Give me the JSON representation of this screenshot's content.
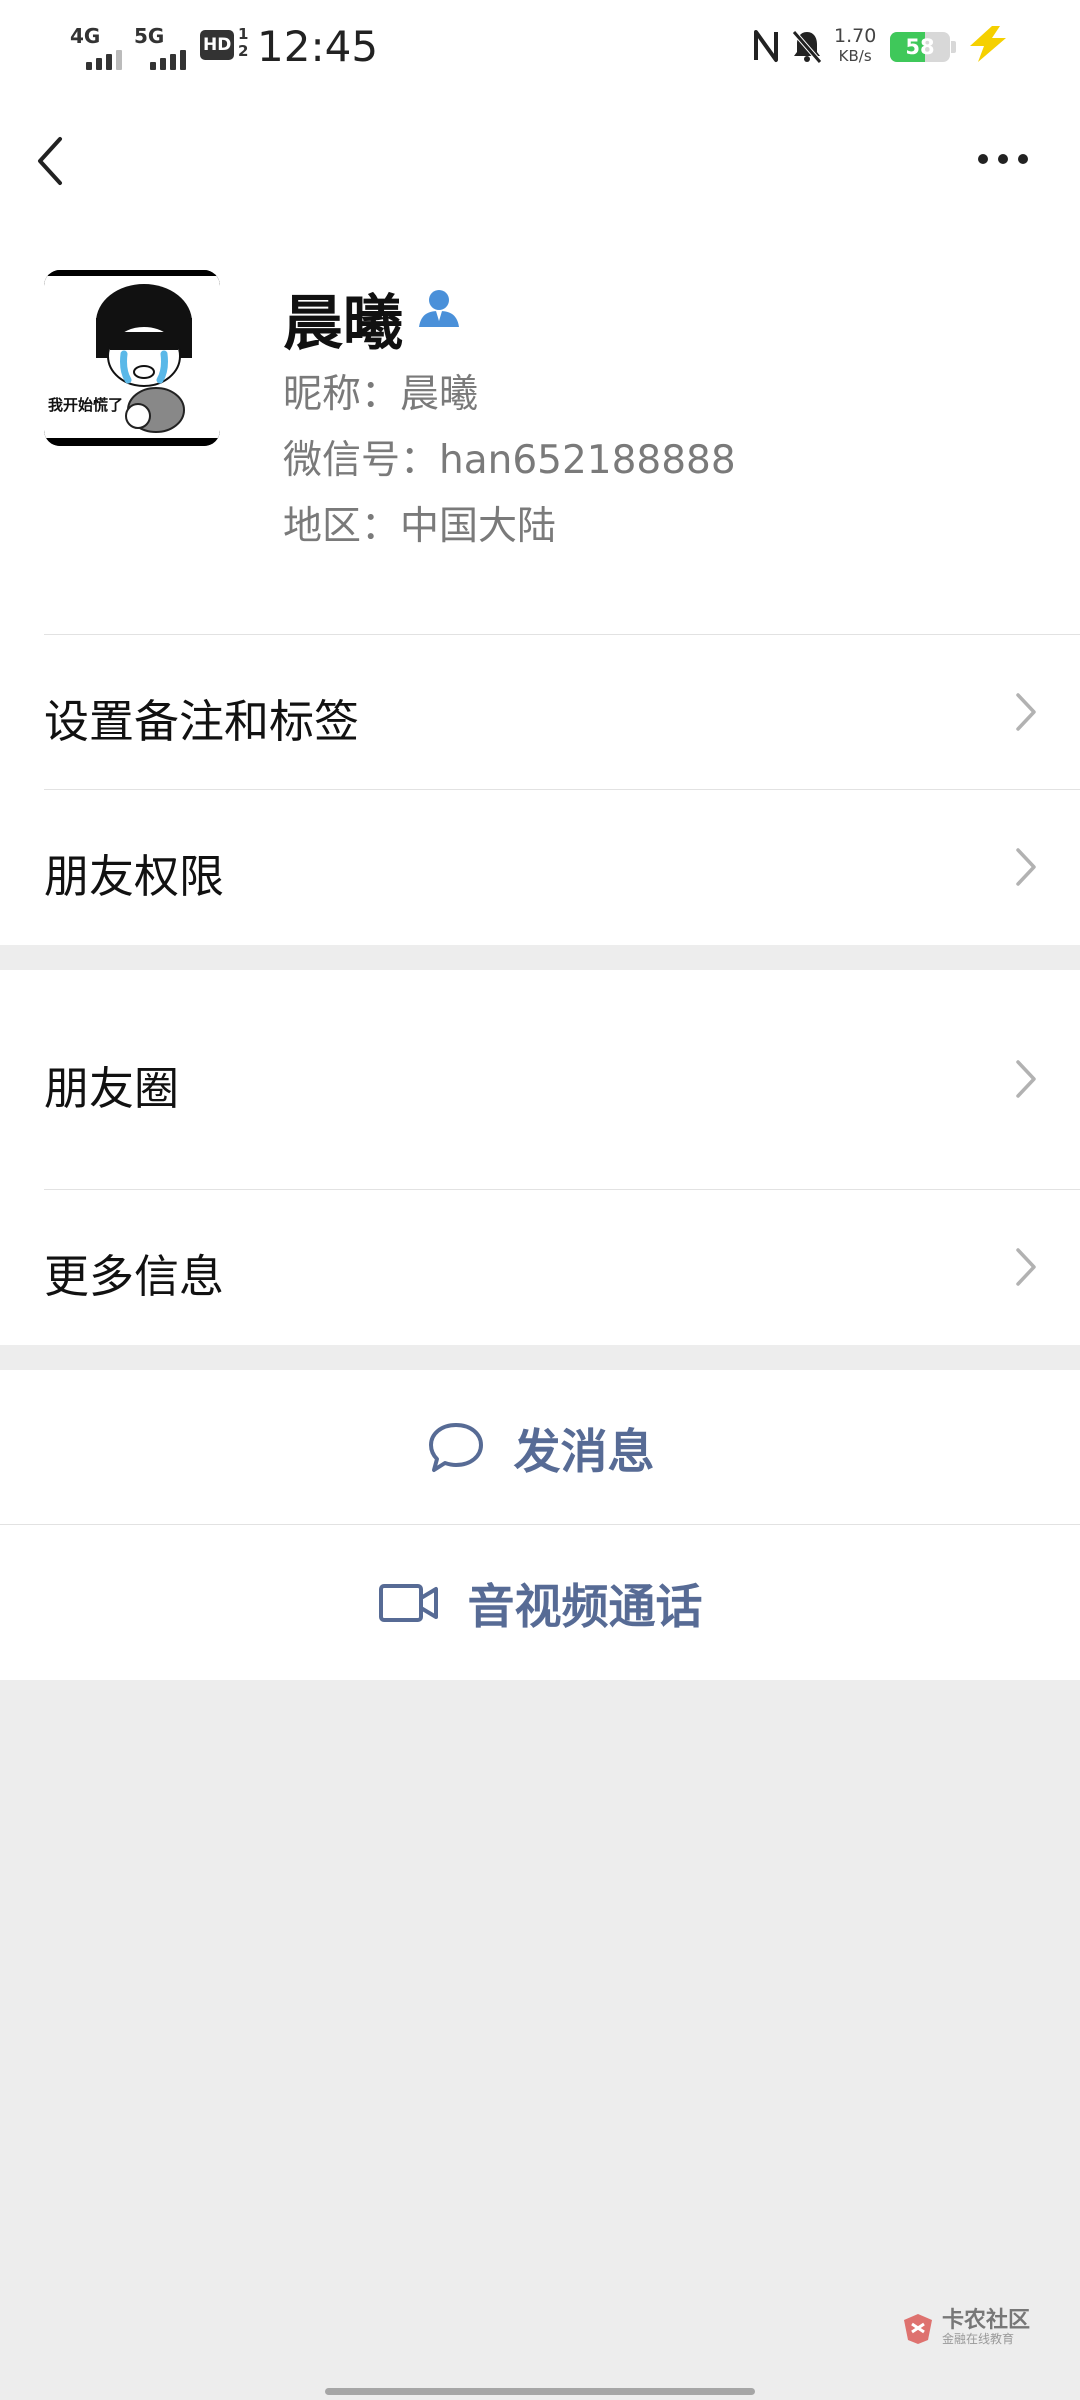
{
  "status_bar": {
    "sim1": "4G",
    "sim2": "5G",
    "hd_badge": "HD",
    "hd_sub_top": "1",
    "hd_sub_bottom": "2",
    "time": "12:45",
    "net_speed": "1.70",
    "net_speed_unit": "KB/s",
    "battery_level": 58,
    "battery_text": "58",
    "colors": {
      "battery": "#3fc85a",
      "charging": "#f5d000"
    }
  },
  "top_bar": {
    "back_icon": "chevron-left-icon",
    "more_icon": "more-horizontal-icon"
  },
  "profile": {
    "avatar_caption": "我开始慌了",
    "name": "晨曦",
    "nickname": "昵称：晨曦",
    "wechat_id": "微信号：han652188888",
    "region": "地区：中国大陆"
  },
  "menu": {
    "remark_tags": "设置备注和标签",
    "friend_permissions": "朋友权限",
    "moments": "朋友圈",
    "more_info": "更多信息"
  },
  "actions": {
    "send_message": "发消息",
    "video_call": "音视频通话",
    "accent_color": "#576b95"
  },
  "watermark": {
    "title": "卡农社区",
    "subtitle": "金融在线教育"
  }
}
